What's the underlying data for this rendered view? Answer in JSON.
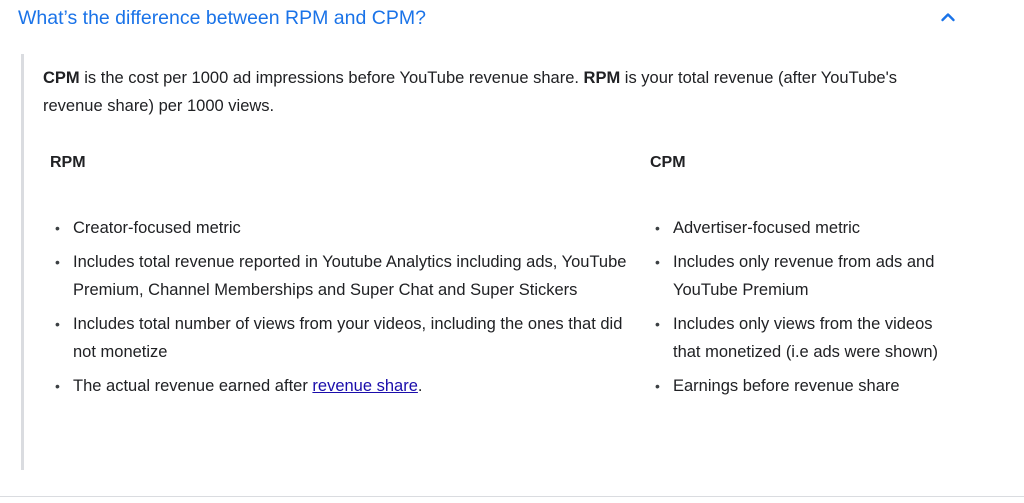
{
  "faq": {
    "question": "What’s the difference between RPM and CPM?",
    "icon": "chevron-up-icon",
    "accent_color": "#1a73e8"
  },
  "intro": {
    "cpm_term": "CPM",
    "cpm_text": " is the cost per 1000 ad impressions before YouTube revenue share. ",
    "rpm_term": "RPM",
    "rpm_text": " is your total revenue (after YouTube's revenue share) per 1000 views."
  },
  "rpm_column": {
    "heading": "RPM",
    "items": [
      "Creator-focused metric",
      "Includes total revenue reported in Youtube Analytics including ads, YouTube Premium, Channel Memberships and Super Chat and Super Stickers",
      "Includes total number of views from your videos, including the ones that did not monetize"
    ],
    "last_item_prefix": "The actual revenue earned after ",
    "last_item_link": "revenue share",
    "last_item_suffix": "."
  },
  "cpm_column": {
    "heading": "CPM",
    "items": [
      "Advertiser-focused metric",
      "Includes only revenue from ads and YouTube Premium",
      "Includes only views from the videos that monetized (i.e ads were shown)",
      "Earnings before revenue share"
    ]
  }
}
